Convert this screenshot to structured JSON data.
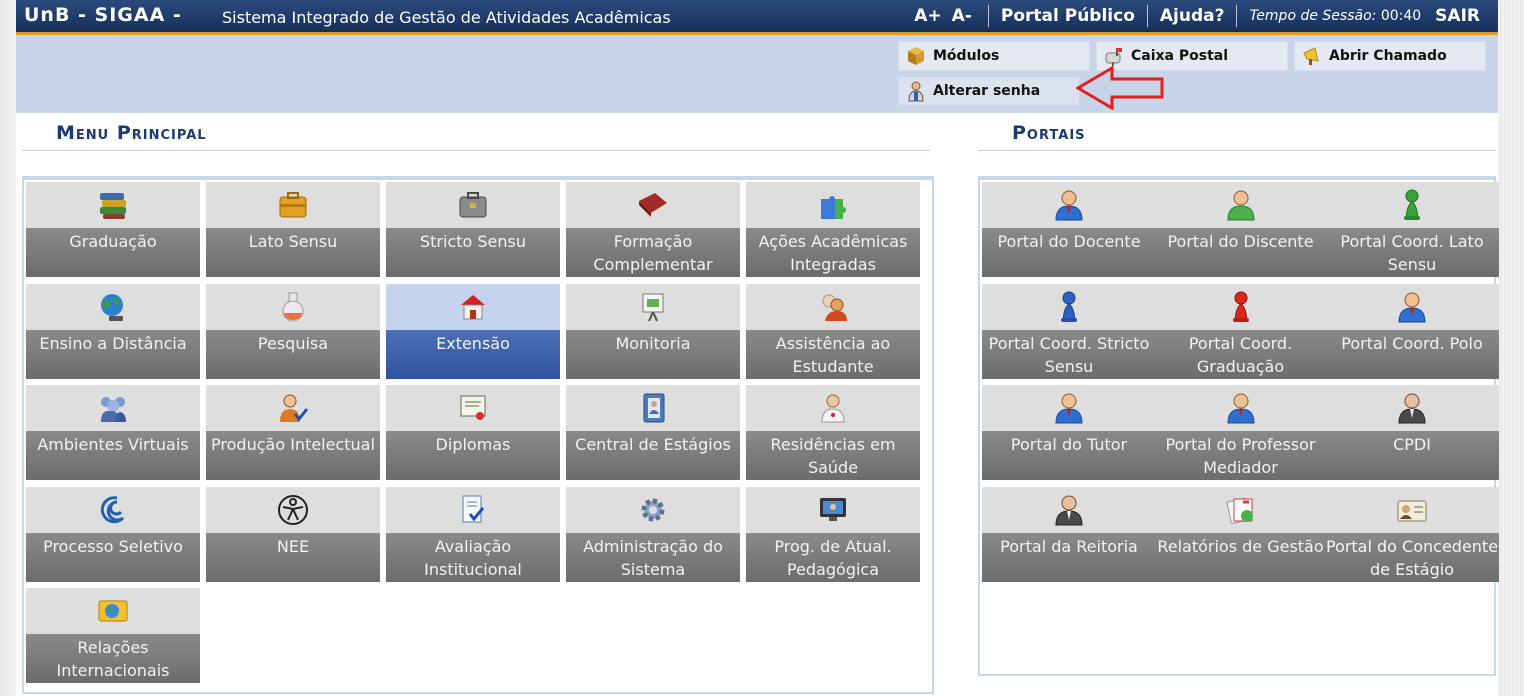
{
  "header": {
    "brand": "UnB - SIGAA -",
    "system_name": "Sistema Integrado de Gestão de Atividades Acadêmicas",
    "font_increase": "A+",
    "font_decrease": "A-",
    "portal_publico": "Portal Público",
    "ajuda": "Ajuda?",
    "session_label": "Tempo de Sessão:",
    "session_time": "00:40",
    "sair": "SAIR"
  },
  "toolbar": {
    "modulos": "Módulos",
    "caixa_postal": "Caixa Postal",
    "abrir_chamado": "Abrir Chamado",
    "alterar_senha": "Alterar senha"
  },
  "menu": {
    "title": "Menu Principal",
    "items": [
      {
        "label": "Graduação",
        "icon": "books-icon"
      },
      {
        "label": "Lato Sensu",
        "icon": "briefcase-icon"
      },
      {
        "label": "Stricto Sensu",
        "icon": "gray-briefcase-icon"
      },
      {
        "label": "Formação Complementar",
        "icon": "red-book-icon"
      },
      {
        "label": "Ações Acadêmicas Integradas",
        "icon": "puzzle-icon"
      },
      {
        "label": "Ensino a Distância",
        "icon": "globe-icon"
      },
      {
        "label": "Pesquisa",
        "icon": "flask-icon"
      },
      {
        "label": "Extensão",
        "icon": "house-icon"
      },
      {
        "label": "Monitoria",
        "icon": "presentation-board-icon"
      },
      {
        "label": "Assistência ao Estudante",
        "icon": "assistance-person-icon"
      },
      {
        "label": "Ambientes Virtuais",
        "icon": "group-people-icon"
      },
      {
        "label": "Produção Intelectual",
        "icon": "person-check-icon"
      },
      {
        "label": "Diplomas",
        "icon": "diploma-icon"
      },
      {
        "label": "Central de Estágios",
        "icon": "contact-book-icon"
      },
      {
        "label": "Residências em Saúde",
        "icon": "doctor-icon"
      },
      {
        "label": "Processo Seletivo",
        "icon": "swirl-logo-icon"
      },
      {
        "label": "NEE",
        "icon": "accessibility-icon"
      },
      {
        "label": "Avaliação Institucional",
        "icon": "document-check-icon"
      },
      {
        "label": "Administração do Sistema",
        "icon": "gears-icon"
      },
      {
        "label": "Prog. de Atual. Pedagógica",
        "icon": "monitor-icon"
      },
      {
        "label": "Relações Internacionais",
        "icon": "world-folder-icon"
      }
    ]
  },
  "portais": {
    "title": "Portais",
    "items": [
      {
        "label": "Portal do Docente",
        "icon": "user-blue-icon"
      },
      {
        "label": "Portal do Discente",
        "icon": "user-green-icon"
      },
      {
        "label": "Portal Coord. Lato Sensu",
        "icon": "pawn-green-icon"
      },
      {
        "label": "Portal Coord. Stricto Sensu",
        "icon": "pawn-blue-icon"
      },
      {
        "label": "Portal Coord. Graduação",
        "icon": "pawn-red-icon"
      },
      {
        "label": "Portal Coord. Polo",
        "icon": "user-blue-icon"
      },
      {
        "label": "Portal do Tutor",
        "icon": "user-blue-icon"
      },
      {
        "label": "Portal do Professor Mediador",
        "icon": "user-blue-icon"
      },
      {
        "label": "CPDI",
        "icon": "user-suit-icon"
      },
      {
        "label": "Portal da Reitoria",
        "icon": "user-suit-icon"
      },
      {
        "label": "Relatórios de Gestão",
        "icon": "reports-icon"
      },
      {
        "label": "Portal do Concedente de Estágio",
        "icon": "id-card-icon"
      }
    ]
  }
}
